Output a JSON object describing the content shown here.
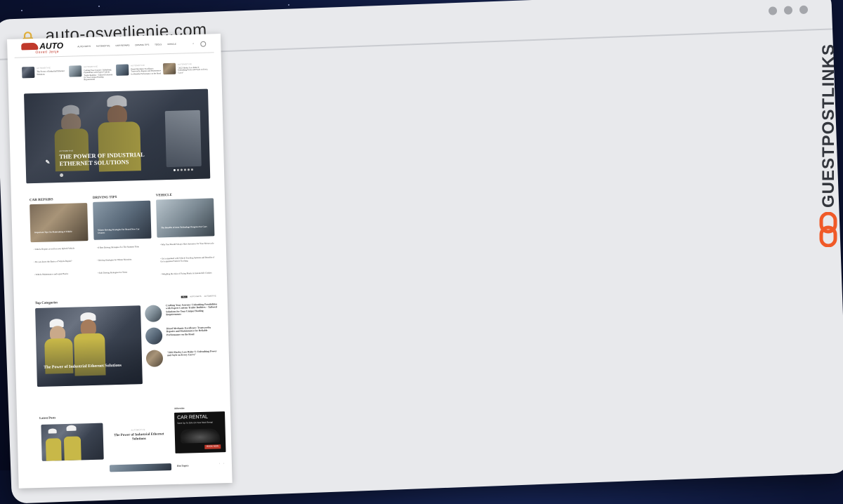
{
  "browser": {
    "url": "auto-osvetljenje.com",
    "lock_icon": "lock-icon"
  },
  "watermark": {
    "text": "GUESTPOSTLINKS",
    "icon": "chain-link-icon",
    "icon_color": "#f05a28"
  },
  "site": {
    "logo_top": "AUTO",
    "logo_bottom": "Osvetl Jenje",
    "nav": [
      "AUTO PARTS",
      "AUTOMOTIVE",
      "CAR REPAIRS",
      "DRIVING TIPS",
      "TOOLS",
      "VEHICLE"
    ]
  },
  "ticker": [
    {
      "label": "AUTOMOTIVE",
      "title": "The Power of Industrial Ethernet Solutions"
    },
    {
      "label": "AUTOMOTIVE",
      "title": "Crafting Your Journey: Unleashing Possibilities with Expert Custom Trailer Builders – Tailored Solutions for Your Unique Hauling Requirements"
    },
    {
      "label": "AUTOMOTIVE",
      "title": "Diesel Mechanic Excellence: Trustworthy Repairs and Maintenance for Reliable Performance on the Road"
    },
    {
      "label": "AUTOMOTIVE",
      "title": "\"2022 Harley Low Rider S: Unleashing Power and Style on Every Curve\""
    }
  ],
  "hero": {
    "label": "AUTOMOTIVE",
    "title_line1": "THE POWER OF INDUSTRIAL",
    "title_line2": "ETHERNET SOLUTIONS"
  },
  "columns": [
    {
      "heading": "CAR REPAIRS",
      "feature": "Important Tips On Maintaining A Vehicle",
      "items": [
        "Vehicle Repairs as well as your Hybrid Vehicle",
        "Do you know the Basics of Vehicle Repair?",
        "Vehicle Maintenance and repair Basics"
      ]
    },
    {
      "heading": "DRIVING TIPS",
      "feature": "Winter Driving Strategies For Brand New Car Owners",
      "items": [
        "8 Best Driving Strategies For The Summer Time",
        "Driving Strategies for Winter Motorists",
        "Safe Driving Strategies For Teens"
      ]
    },
    {
      "heading": "VEHICLE",
      "feature": "The Benefits of Auto Technology Progress For Cars",
      "items": [
        "Why You Should Always Have Insurance for Your Motorcycle",
        "Get acquainted with Vehicle Tracking Systems and Benefits of Get acquainted Vehicle Tracking",
        "Weighing the risks of Fixing Marks in Automobile Crashes"
      ]
    }
  ],
  "top_categories": {
    "heading": "Top Categories",
    "tabs": [
      "ALL",
      "AUTO PARTS",
      "AUTOMOTIVE"
    ],
    "feature": "The Power of Industrial Ethernet Solutions",
    "side": [
      "Crafting Your Journey: Unleashing Possibilities with Expert Custom Trailer Builders – Tailored Solutions for Your Unique Hauling Requirements",
      "Diesel Mechanic Excellence: Trustworthy Repairs and Maintenance for Reliable Performance on the Road",
      "\"2022 Harley Low Rider S: Unleashing Power and Style on Every Curve\""
    ]
  },
  "latest": {
    "heading": "Latest Posts",
    "label": "AUTOMOTIVE",
    "title": "The Power of Industrial Ethernet Solutions"
  },
  "advertise": {
    "heading": "Advertise",
    "ad_title": "CAR RENTAL",
    "ad_sub": "Save Up To 25% On Your Next Rental",
    "ad_button": "BOOK NOW"
  },
  "hot_topics": {
    "heading": "Hot Topics"
  },
  "colors": {
    "accent": "#c0392b",
    "hero_overlay": "#1b2230"
  }
}
